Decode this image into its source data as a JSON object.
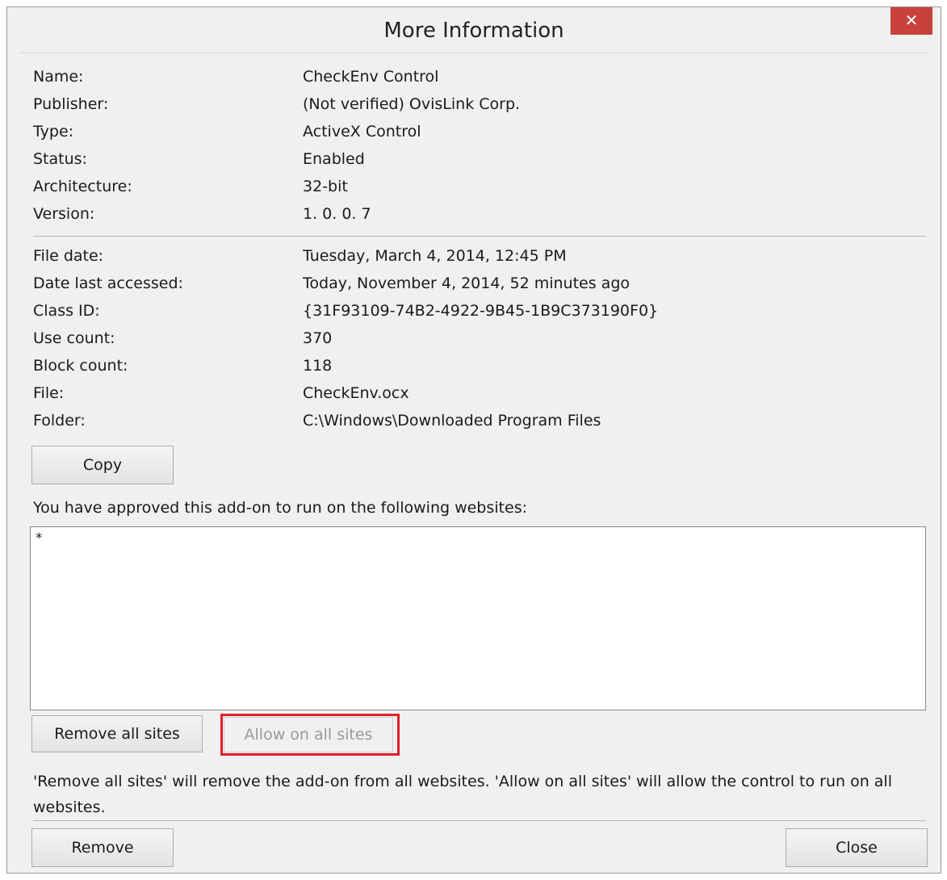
{
  "window": {
    "title": "More Information",
    "close_glyph": "✕"
  },
  "info_group_1": [
    {
      "label": "Name:",
      "value": "CheckEnv Control"
    },
    {
      "label": "Publisher:",
      "value": "(Not verified) OvisLink Corp."
    },
    {
      "label": "Type:",
      "value": "ActiveX Control"
    },
    {
      "label": "Status:",
      "value": "Enabled"
    },
    {
      "label": "Architecture:",
      "value": "32-bit"
    },
    {
      "label": "Version:",
      "value": "1. 0. 0. 7"
    }
  ],
  "info_group_2": [
    {
      "label": "File date:",
      "value": "Tuesday, March 4, 2014, 12:45 PM"
    },
    {
      "label": "Date last accessed:",
      "value": "Today, November 4, 2014, 52 minutes ago"
    },
    {
      "label": "Class ID:",
      "value": "{31F93109-74B2-4922-9B45-1B9C373190F0}"
    },
    {
      "label": "Use count:",
      "value": "370"
    },
    {
      "label": "Block count:",
      "value": "118"
    },
    {
      "label": "File:",
      "value": "CheckEnv.ocx"
    },
    {
      "label": "Folder:",
      "value": "C:\\Windows\\Downloaded Program Files"
    }
  ],
  "buttons": {
    "copy": "Copy",
    "remove_all_sites": "Remove all sites",
    "allow_on_all_sites": "Allow on all sites",
    "remove": "Remove",
    "close": "Close"
  },
  "approved_sites": {
    "label": "You have approved this add-on to run on the following websites:",
    "items": [
      "*"
    ]
  },
  "note": "'Remove all sites' will remove the add-on from all websites. 'Allow on all sites' will allow the control to run on all websites.",
  "colors": {
    "close_button": "#c7423c",
    "highlight_border": "#e0212b",
    "dialog_background": "#f0f0f0"
  }
}
